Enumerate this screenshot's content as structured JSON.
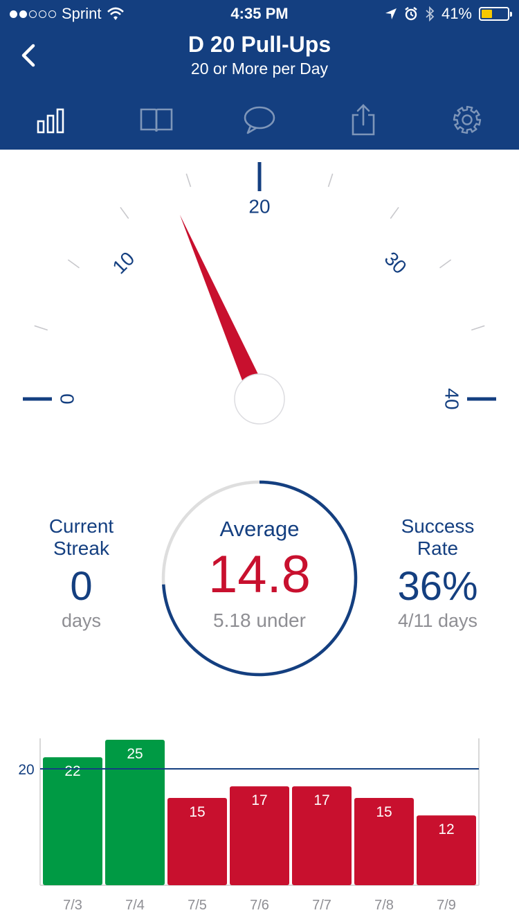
{
  "status_bar": {
    "carrier": "Sprint",
    "time": "4:35 PM",
    "battery": "41%",
    "battery_level": 0.41,
    "signal_bars_filled": 2,
    "signal_bars_total": 5
  },
  "header": {
    "title": "D 20 Pull-Ups",
    "subtitle": "20 or More per Day",
    "background": "#143f80"
  },
  "toolbar": {
    "items": [
      {
        "name": "stats",
        "icon": "bar-chart-icon",
        "active": true
      },
      {
        "name": "journal",
        "icon": "book-icon",
        "active": false
      },
      {
        "name": "comments",
        "icon": "chat-bubble-icon",
        "active": false
      },
      {
        "name": "share",
        "icon": "share-icon",
        "active": false
      },
      {
        "name": "settings",
        "icon": "gear-icon",
        "active": false
      }
    ]
  },
  "gauge": {
    "min": 0,
    "max": 40,
    "major_labels": [
      "0",
      "10",
      "20",
      "30",
      "40"
    ],
    "value": 14.8,
    "needle_color": "#c8102e"
  },
  "stats": {
    "streak": {
      "label_line1": "Current",
      "label_line2": "Streak",
      "value": "0",
      "unit": "days"
    },
    "average": {
      "label": "Average",
      "value": "14.8",
      "sub": "5.18 under",
      "progress": 0.74
    },
    "success": {
      "label_line1": "Success",
      "label_line2": "Rate",
      "value": "36%",
      "unit": "4/11 days"
    }
  },
  "colors": {
    "accent": "#143f80",
    "over_goal": "#009a44",
    "under_goal": "#c8102e",
    "muted": "#8e8e93"
  },
  "chart_data": {
    "type": "bar",
    "categories": [
      "7/3",
      "7/4",
      "7/5",
      "7/6",
      "7/7",
      "7/8",
      "7/9"
    ],
    "values": [
      22,
      25,
      15,
      17,
      17,
      15,
      12
    ],
    "goal_line": 20,
    "goal_label": "20",
    "ylim": [
      0,
      25
    ],
    "xlabel": "",
    "ylabel": ""
  }
}
